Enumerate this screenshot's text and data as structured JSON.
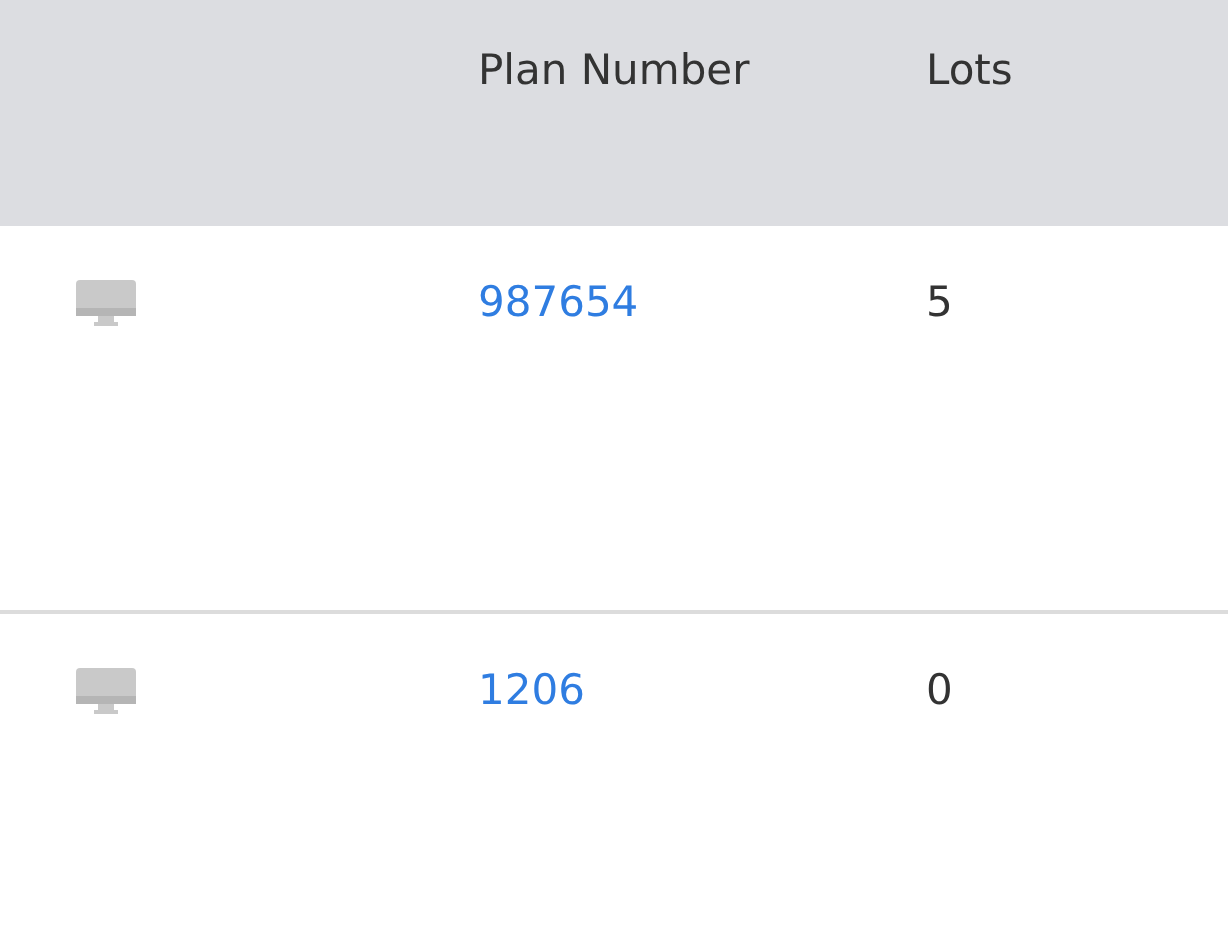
{
  "table": {
    "columns": [
      "Plan Number",
      "Lots"
    ],
    "rows": [
      {
        "plan_number": "987654",
        "lots": "5"
      },
      {
        "plan_number": "1206",
        "lots": "0"
      }
    ]
  }
}
